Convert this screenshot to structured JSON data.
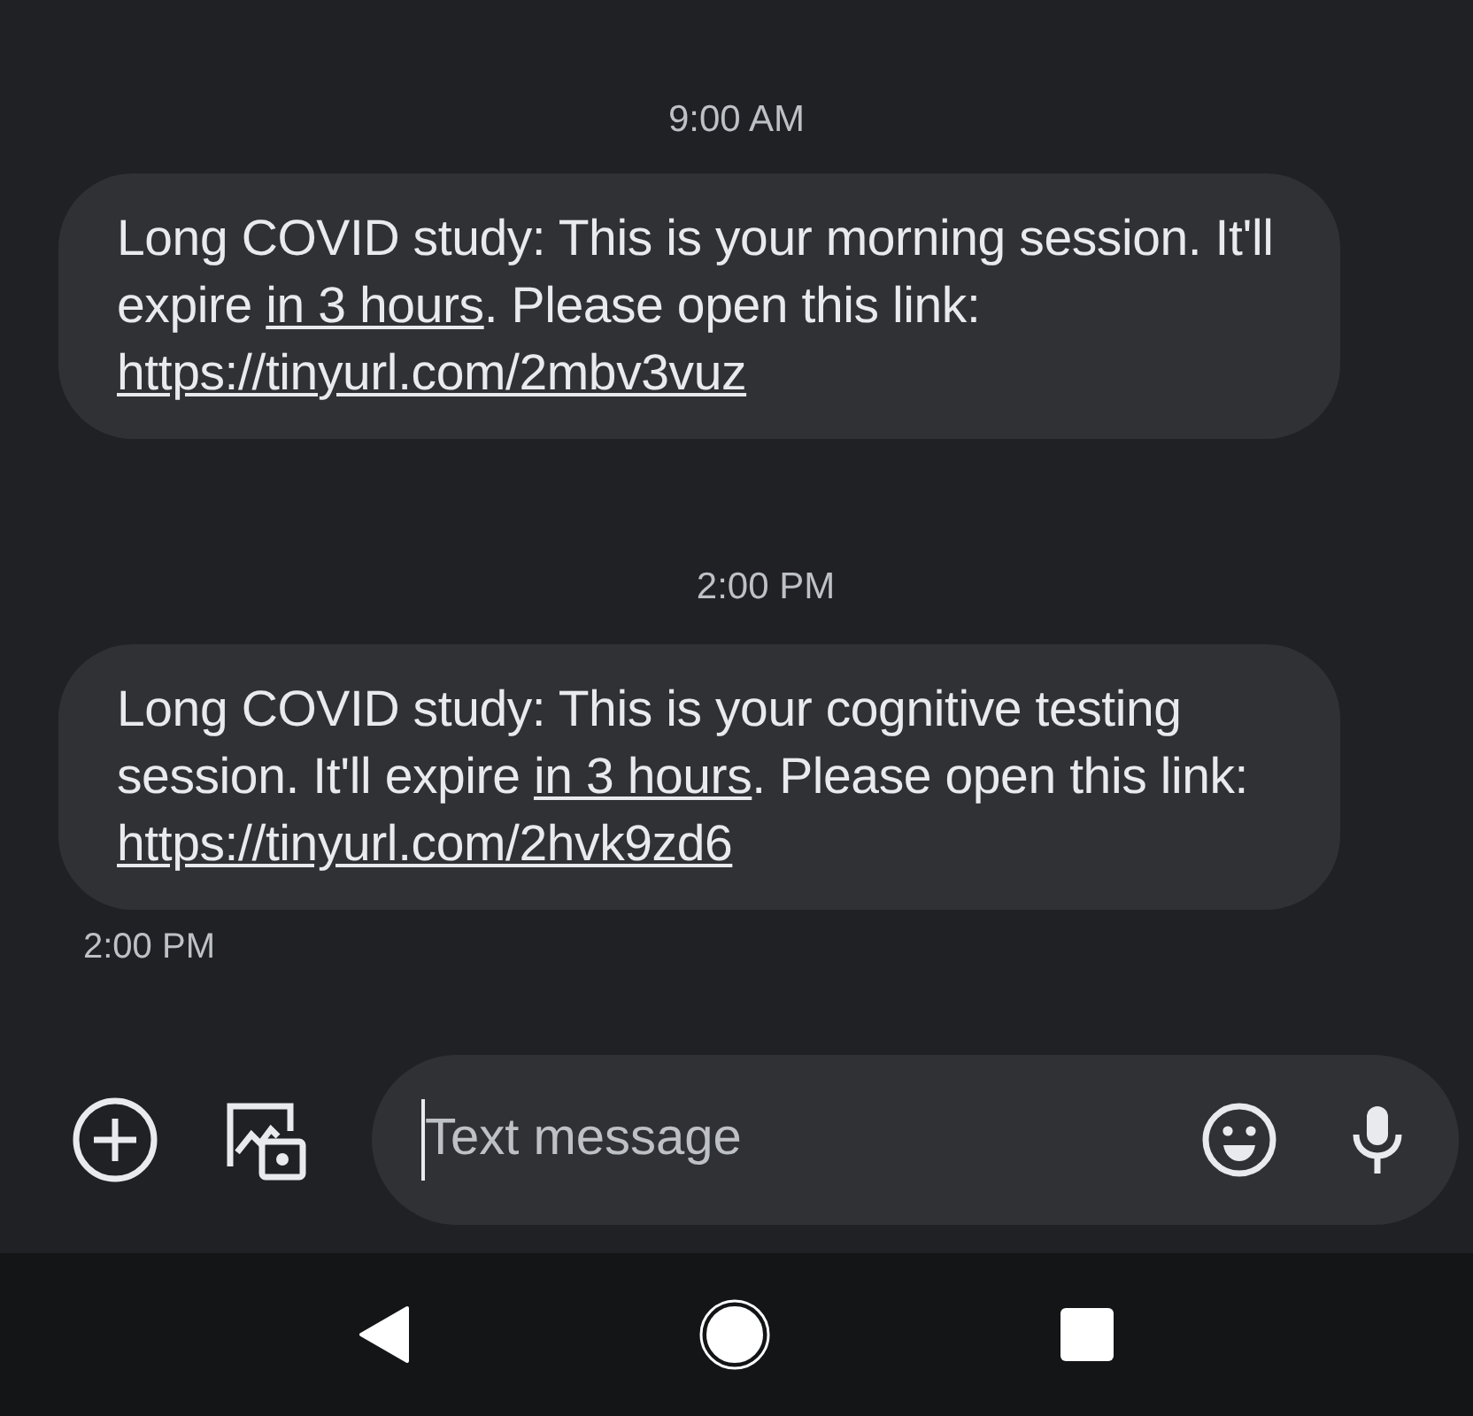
{
  "conversation": [
    {
      "kind": "timestamp",
      "text": "9:00 AM"
    },
    {
      "kind": "message",
      "segments": [
        {
          "kind": "text",
          "text": "Long COVID study: This is your morning session. It'll expire "
        },
        {
          "kind": "link",
          "text": "in 3 hours"
        },
        {
          "kind": "text",
          "text": ". Please open this link: "
        },
        {
          "kind": "link",
          "text": "https://tinyurl.com/2mbv3vuz"
        }
      ]
    },
    {
      "kind": "timestamp",
      "text": "2:00 PM"
    },
    {
      "kind": "message",
      "segments": [
        {
          "kind": "text",
          "text": "Long COVID study: This is your cognitive testing session. It'll expire "
        },
        {
          "kind": "link",
          "text": "in 3 hours"
        },
        {
          "kind": "text",
          "text": ". Please open this link: "
        },
        {
          "kind": "link",
          "text": "https://tinyurl.com/2hvk9zd6"
        }
      ]
    },
    {
      "kind": "sent_time",
      "text": "2:00 PM"
    }
  ],
  "composer": {
    "placeholder": "Text message"
  }
}
